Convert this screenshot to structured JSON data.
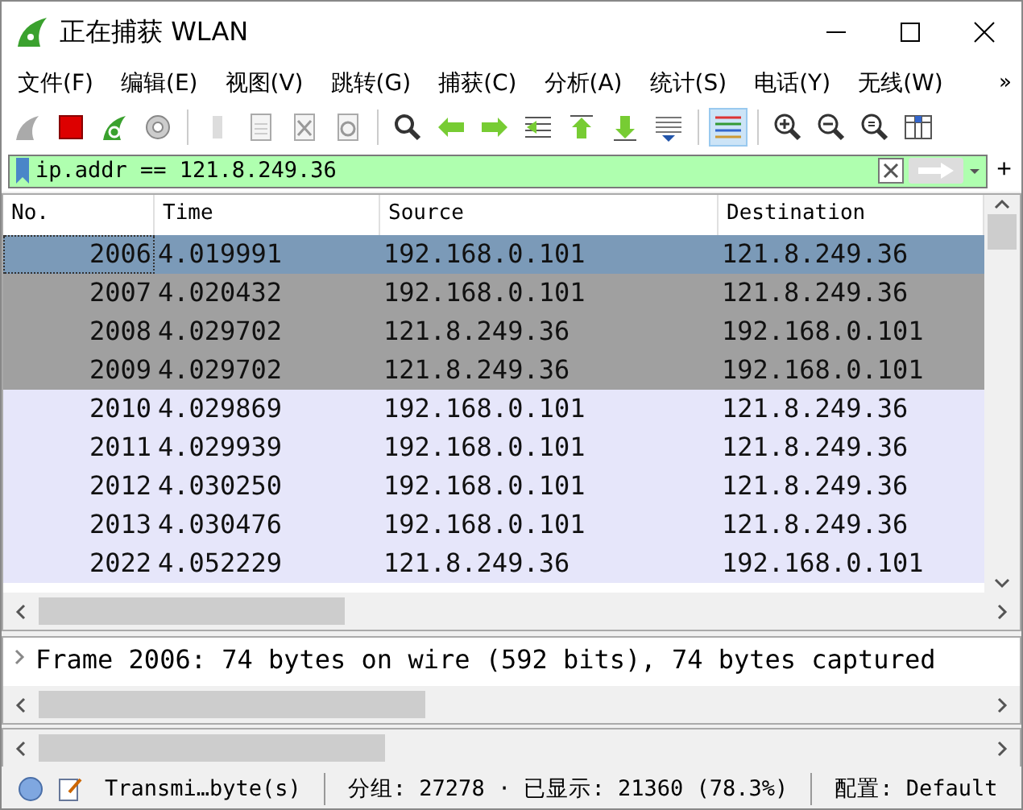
{
  "window": {
    "title": "正在捕获 WLAN"
  },
  "menu": [
    "文件(F)",
    "编辑(E)",
    "视图(V)",
    "跳转(G)",
    "捕获(C)",
    "分析(A)",
    "统计(S)",
    "电话(Y)",
    "无线(W)"
  ],
  "menu_overflow": "»",
  "toolbar": {
    "coloring_selected": true
  },
  "filter": {
    "value": "ip.addr == 121.8.249.36",
    "add": "+"
  },
  "packet_list": {
    "columns": [
      "No.",
      "Time",
      "Source",
      "Destination"
    ],
    "rows": [
      {
        "no": "2006",
        "time": "4.019991",
        "source": "192.168.0.101",
        "destination": "121.8.249.36",
        "selected": true,
        "color": "#7b9ab8"
      },
      {
        "no": "2007",
        "time": "4.020432",
        "source": "192.168.0.101",
        "destination": "121.8.249.36",
        "selected": false,
        "color": "#a0a0a0"
      },
      {
        "no": "2008",
        "time": "4.029702",
        "source": "121.8.249.36",
        "destination": "192.168.0.101",
        "selected": false,
        "color": "#a0a0a0"
      },
      {
        "no": "2009",
        "time": "4.029702",
        "source": "121.8.249.36",
        "destination": "192.168.0.101",
        "selected": false,
        "color": "#a0a0a0"
      },
      {
        "no": "2010",
        "time": "4.029869",
        "source": "192.168.0.101",
        "destination": "121.8.249.36",
        "selected": false,
        "color": "#e6e6fa"
      },
      {
        "no": "2011",
        "time": "4.029939",
        "source": "192.168.0.101",
        "destination": "121.8.249.36",
        "selected": false,
        "color": "#e6e6fa"
      },
      {
        "no": "2012",
        "time": "4.030250",
        "source": "192.168.0.101",
        "destination": "121.8.249.36",
        "selected": false,
        "color": "#e6e6fa"
      },
      {
        "no": "2013",
        "time": "4.030476",
        "source": "192.168.0.101",
        "destination": "121.8.249.36",
        "selected": false,
        "color": "#e6e6fa"
      },
      {
        "no": "2022",
        "time": "4.052229",
        "source": "121.8.249.36",
        "destination": "192.168.0.101",
        "selected": false,
        "color": "#e6e6fa"
      }
    ]
  },
  "details": {
    "line": "Frame 2006: 74 bytes on wire (592 bits), 74 bytes captured",
    "expanded": false
  },
  "status_bar": {
    "status": "Transmi…byte(s)",
    "packets": "分组: 27278 · 已显示: 21360 (78.3%)",
    "profile": "配置: Default"
  }
}
